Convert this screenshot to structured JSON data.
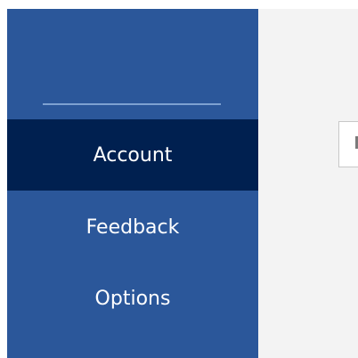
{
  "nav": {
    "items": [
      {
        "label": "Account",
        "selected": true
      },
      {
        "label": "Feedback",
        "selected": false
      },
      {
        "label": "Options",
        "selected": false
      }
    ]
  },
  "colors": {
    "nav_background": "#2b579a",
    "nav_selected": "#002050",
    "content_background": "#f3f3f3"
  }
}
